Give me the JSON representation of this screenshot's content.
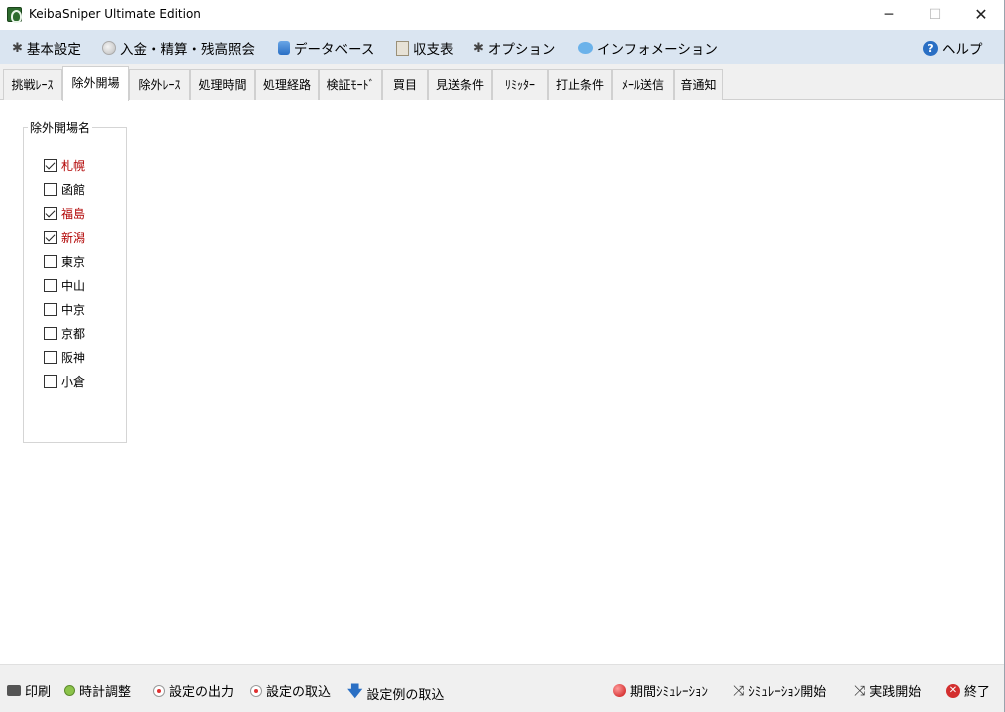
{
  "window": {
    "title": "KeibaSniper Ultimate Edition",
    "minimize_glyph": "─",
    "maximize_glyph": "☐",
    "close_glyph": "✕"
  },
  "menu": {
    "items": [
      {
        "label": "基本設定",
        "icon": "gear-icon"
      },
      {
        "label": "入金・精算・残高照会",
        "icon": "coin-icon"
      },
      {
        "label": "データベース",
        "icon": "database-icon"
      },
      {
        "label": "収支表",
        "icon": "ledger-icon"
      },
      {
        "label": "オプション",
        "icon": "gear-icon"
      },
      {
        "label": "インフォメーション",
        "icon": "speech-bubble-icon"
      }
    ],
    "help_label": "ヘルプ",
    "help_glyph": "?"
  },
  "tabs": [
    {
      "label": "挑戦ﾚｰｽ"
    },
    {
      "label": "除外開場",
      "active": true
    },
    {
      "label": "除外ﾚｰｽ"
    },
    {
      "label": "処理時間"
    },
    {
      "label": "処理経路"
    },
    {
      "label": "検証ﾓｰﾄﾞ"
    },
    {
      "label": "買目"
    },
    {
      "label": "見送条件"
    },
    {
      "label": "ﾘﾐｯﾀｰ"
    },
    {
      "label": "打止条件"
    },
    {
      "label": "ﾒｰﾙ送信"
    },
    {
      "label": "音通知"
    }
  ],
  "venue_group": {
    "label": "除外開場名",
    "venues": [
      {
        "name": "札幌",
        "checked": true
      },
      {
        "name": "函館",
        "checked": false
      },
      {
        "name": "福島",
        "checked": true
      },
      {
        "name": "新潟",
        "checked": true
      },
      {
        "name": "東京",
        "checked": false
      },
      {
        "name": "中山",
        "checked": false
      },
      {
        "name": "中京",
        "checked": false
      },
      {
        "name": "京都",
        "checked": false
      },
      {
        "name": "阪神",
        "checked": false
      },
      {
        "name": "小倉",
        "checked": false
      }
    ]
  },
  "bottom": {
    "left": [
      {
        "label": "印刷",
        "icon": "printer-icon"
      },
      {
        "label": "時計調整",
        "icon": "clock-icon"
      },
      {
        "label": "設定の出力",
        "icon": "export-icon"
      },
      {
        "label": "設定の取込",
        "icon": "import-icon"
      },
      {
        "label": "設定例の取込",
        "icon": "download-arrow-icon"
      }
    ],
    "right": [
      {
        "label": "期間ｼﾐｭﾚｰｼｮﾝ",
        "icon": "red-ball-icon"
      },
      {
        "label": "ｼﾐｭﾚｰｼｮﾝ開始",
        "icon": "shuffle-icon"
      },
      {
        "label": "実践開始",
        "icon": "shuffle-icon"
      },
      {
        "label": "終了",
        "icon": "close-circle-icon"
      }
    ]
  },
  "colors": {
    "menubar_bg": "#dae5f1",
    "checked_text": "#b00000",
    "panel_bg": "#f0f0f0"
  }
}
